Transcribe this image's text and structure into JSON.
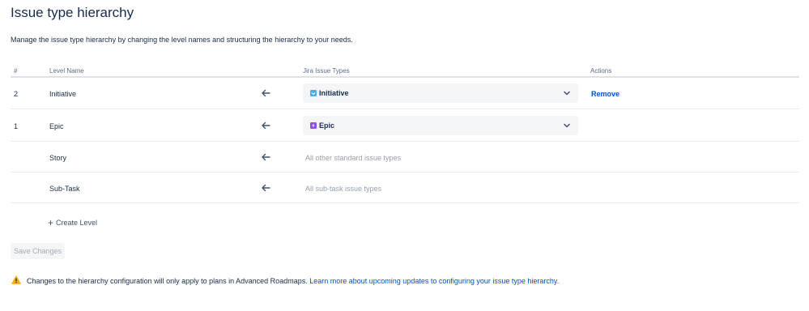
{
  "page": {
    "title": "Issue type hierarchy",
    "description": "Manage the issue type hierarchy by changing the level names and structuring the hierarchy to your needs."
  },
  "table": {
    "headers": {
      "number": "#",
      "level_name": "Level Name",
      "issue_types": "Jira Issue Types",
      "actions": "Actions"
    },
    "rows": [
      {
        "number": "2",
        "level_name": "Initiative",
        "issue_type": "Initiative",
        "issue_type_icon": "initiative-icon",
        "icon_color": "#4bade8",
        "action": "Remove"
      },
      {
        "number": "1",
        "level_name": "Epic",
        "issue_type": "Epic",
        "issue_type_icon": "epic-icon",
        "icon_color": "#904ee2",
        "action": ""
      },
      {
        "number": "",
        "level_name": "Story",
        "issue_type_text": "All other standard issue types"
      },
      {
        "number": "",
        "level_name": "Sub-Task",
        "issue_type_text": "All sub-task issue types"
      }
    ]
  },
  "create_level_label": "Create Level",
  "save_button_label": "Save Changes",
  "notice": {
    "text": "Changes to the hierarchy configuration will only apply to plans in Advanced Roadmaps.",
    "link_text": "Learn more about upcoming updates to configuring your issue type hierarchy."
  },
  "colors": {
    "link": "#0052cc",
    "warning": "#ffab00",
    "text": "#172b4d",
    "muted": "#97a0af"
  }
}
